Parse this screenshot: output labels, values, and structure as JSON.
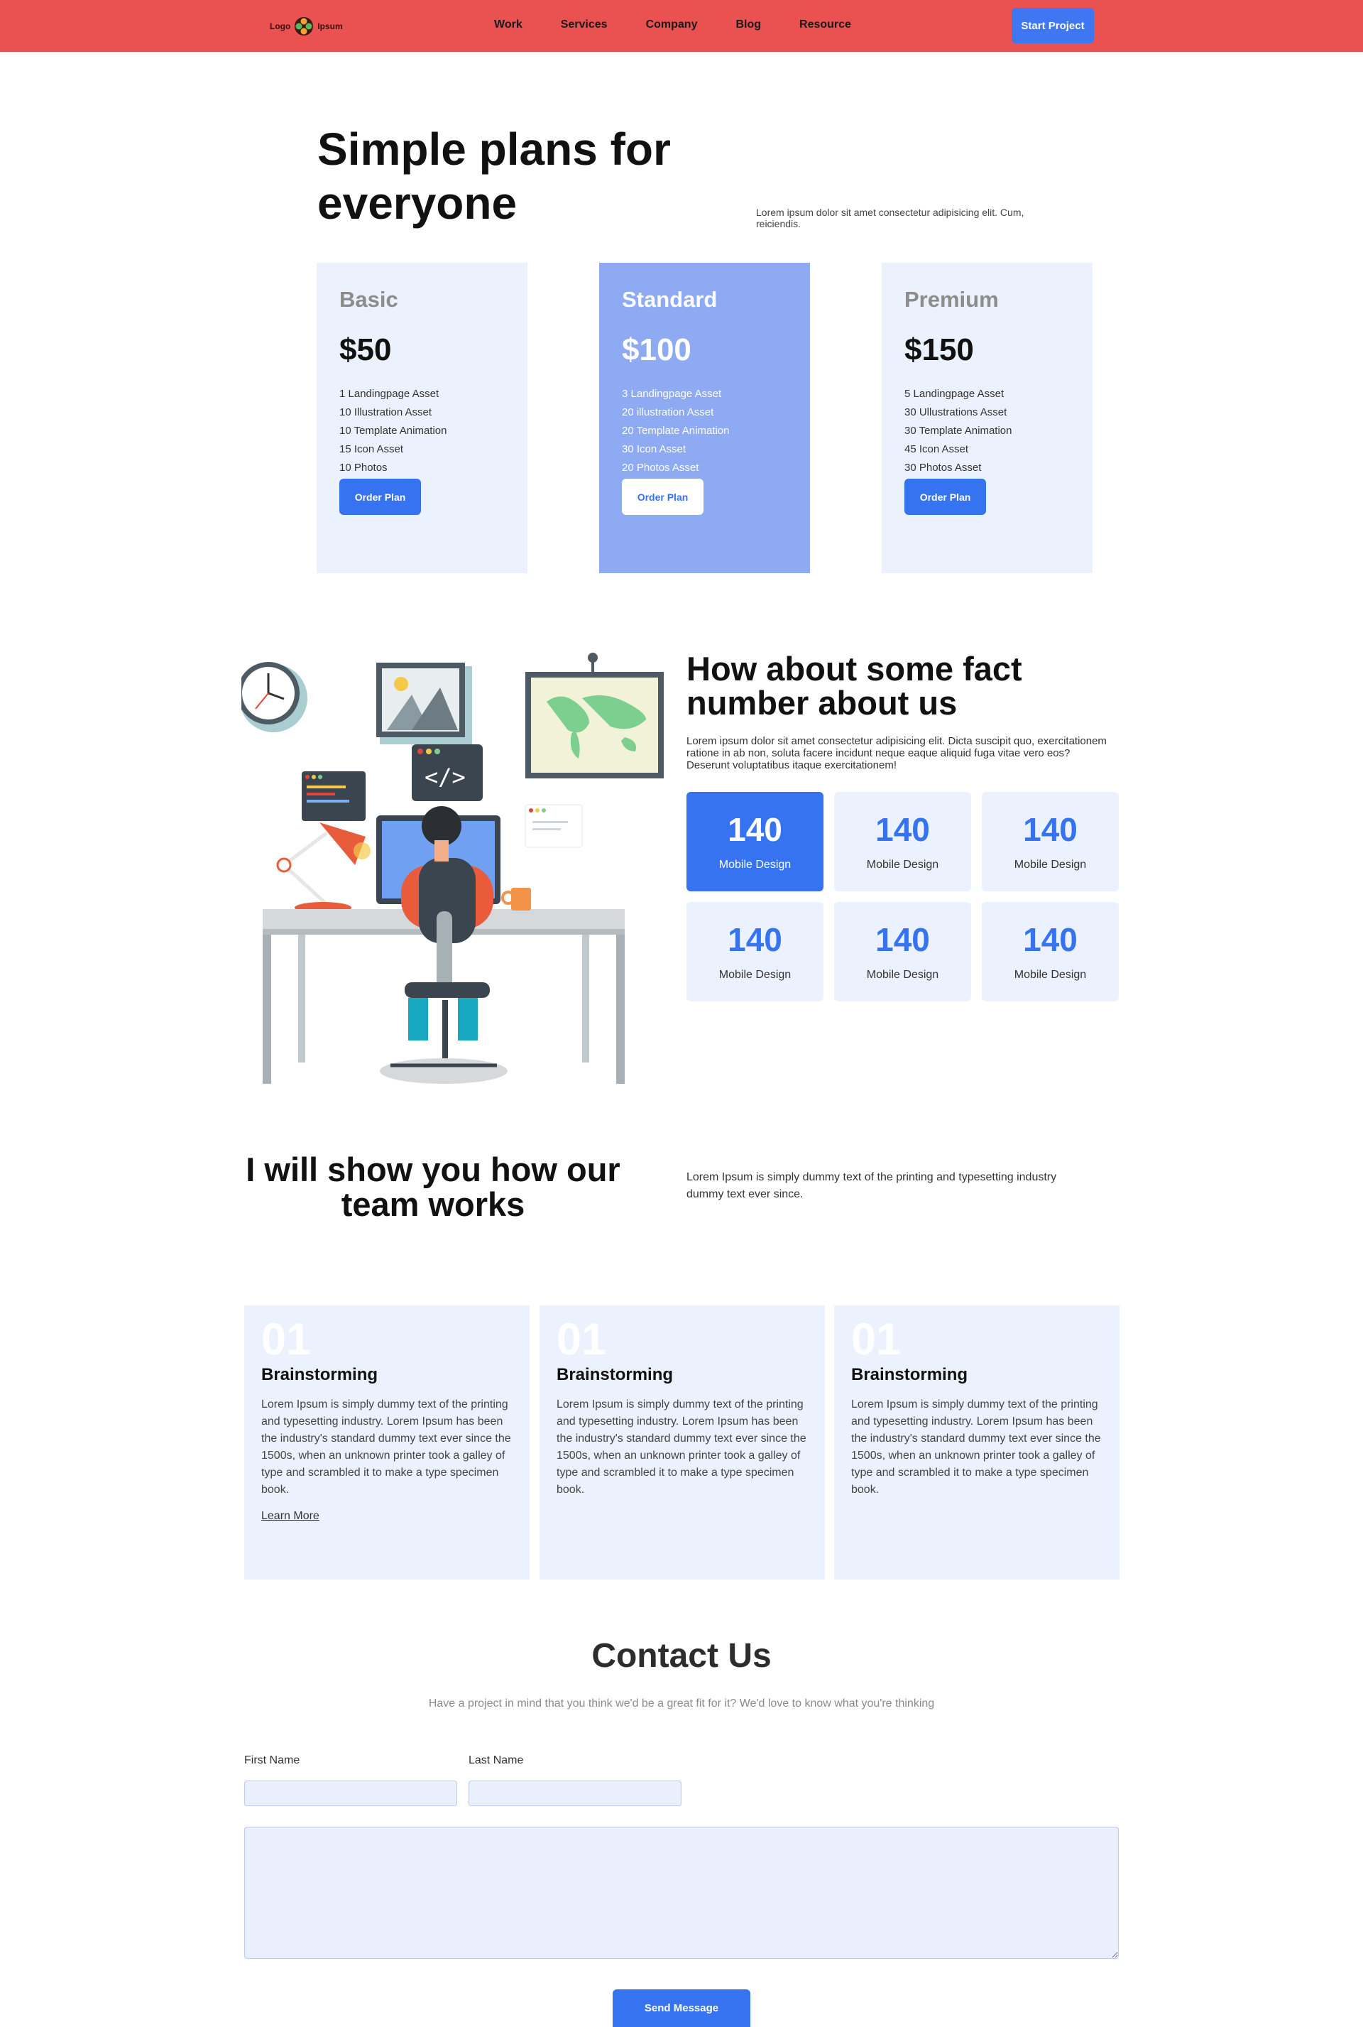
{
  "nav": {
    "logo_left": "Logo",
    "logo_right": "Ipsum",
    "links": [
      "Work",
      "Services",
      "Company",
      "Blog",
      "Resource"
    ],
    "cta": "Start Project"
  },
  "hero": {
    "title": "Simple plans for everyone",
    "description": "Lorem ipsum dolor sit amet consectetur adipisicing elit. Cum, reiciendis."
  },
  "plans": [
    {
      "name": "Basic",
      "price": "$50",
      "features": [
        "1 Landingpage Asset",
        "10 Illustration Asset",
        "10 Template Animation",
        "15 Icon Asset",
        "10 Photos"
      ],
      "button": "Order Plan"
    },
    {
      "name": "Standard",
      "price": "$100",
      "features": [
        "3 Landingpage Asset",
        "20 illustration Asset",
        "20 Template Animation",
        "30 Icon Asset",
        "20 Photos Asset"
      ],
      "button": "Order Plan"
    },
    {
      "name": "Premium",
      "price": "$150",
      "features": [
        "5 Landingpage Asset",
        "30 Ullustrations Asset",
        "30 Template Animation",
        "45 Icon Asset",
        "30 Photos Asset"
      ],
      "button": "Order Plan"
    }
  ],
  "facts": {
    "title": "How about some fact number about us",
    "description": "Lorem ipsum dolor sit amet consectetur adipisicing elit. Dicta suscipit quo, exercitationem ratione in ab non, soluta facere incidunt neque eaque aliquid fuga vitae vero eos? Deserunt voluptatibus itaque exercitationem!",
    "stats": [
      {
        "value": "140",
        "label": "Mobile Design"
      },
      {
        "value": "140",
        "label": "Mobile Design"
      },
      {
        "value": "140",
        "label": "Mobile Design"
      },
      {
        "value": "140",
        "label": "Mobile Design"
      },
      {
        "value": "140",
        "label": "Mobile Design"
      },
      {
        "value": "140",
        "label": "Mobile Design"
      }
    ],
    "illustration_icons": [
      "wall-clock-icon",
      "picture-frame-icon",
      "world-map-icon",
      "code-window-icon",
      "desk-lamp-icon",
      "coffee-mug-icon"
    ]
  },
  "team": {
    "title": "I will show you how our team works",
    "description": "Lorem Ipsum is simply dummy text of the printing and typesetting industry dummy text ever since.",
    "steps": [
      {
        "number": "01",
        "title": "Brainstorming",
        "text": "Lorem Ipsum is simply dummy text of the printing and typesetting industry. Lorem Ipsum has been the industry's standard dummy text ever since the 1500s, when an unknown printer took a galley of type and scrambled it to make a type specimen book.",
        "link": "Learn More"
      },
      {
        "number": "01",
        "title": "Brainstorming",
        "text": "Lorem Ipsum is simply dummy text of the printing and typesetting industry. Lorem Ipsum has been the industry's standard dummy text ever since the 1500s, when an unknown printer took a galley of type and scrambled it to make a type specimen book."
      },
      {
        "number": "01",
        "title": "Brainstorming",
        "text": "Lorem Ipsum is simply dummy text of the printing and typesetting industry. Lorem Ipsum has been the industry's standard dummy text ever since the 1500s, when an unknown printer took a galley of type and scrambled it to make a type specimen book."
      }
    ]
  },
  "contact": {
    "title": "Contact Us",
    "subtitle": "Have a project in mind that you think we'd be a great fit for it? We'd love to know what you're thinking",
    "first_name_label": "First Name",
    "last_name_label": "Last Name",
    "first_name_value": "",
    "last_name_value": "",
    "message_value": "",
    "send": "Send Message"
  },
  "colors": {
    "nav_bg": "#ea5252",
    "primary": "#3573f0",
    "featured_plan": "#8eaaf3",
    "card_bg": "#ecf2fd"
  }
}
